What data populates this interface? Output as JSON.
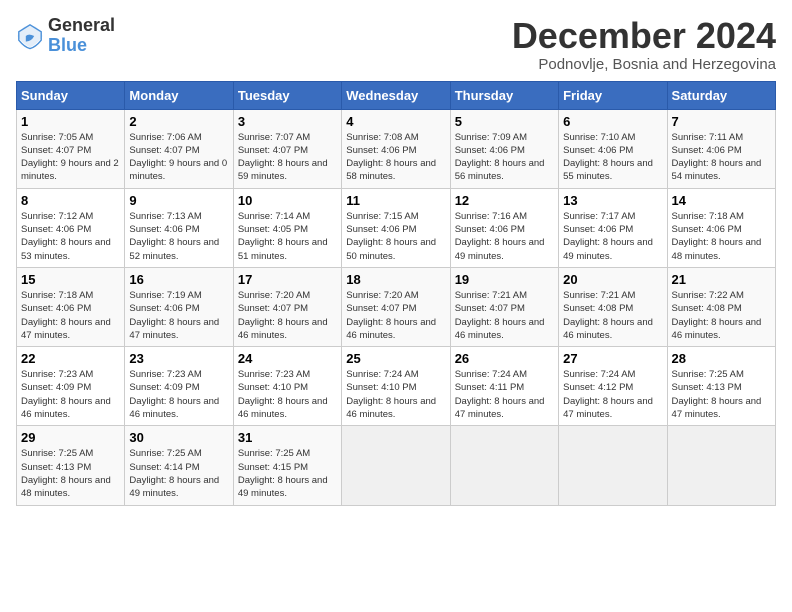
{
  "header": {
    "logo_line1": "General",
    "logo_line2": "Blue",
    "month_year": "December 2024",
    "location": "Podnovlje, Bosnia and Herzegovina"
  },
  "weekdays": [
    "Sunday",
    "Monday",
    "Tuesday",
    "Wednesday",
    "Thursday",
    "Friday",
    "Saturday"
  ],
  "weeks": [
    [
      {
        "day": "1",
        "sunrise": "7:05 AM",
        "sunset": "4:07 PM",
        "daylight": "9 hours and 2 minutes."
      },
      {
        "day": "2",
        "sunrise": "7:06 AM",
        "sunset": "4:07 PM",
        "daylight": "9 hours and 0 minutes."
      },
      {
        "day": "3",
        "sunrise": "7:07 AM",
        "sunset": "4:07 PM",
        "daylight": "8 hours and 59 minutes."
      },
      {
        "day": "4",
        "sunrise": "7:08 AM",
        "sunset": "4:06 PM",
        "daylight": "8 hours and 58 minutes."
      },
      {
        "day": "5",
        "sunrise": "7:09 AM",
        "sunset": "4:06 PM",
        "daylight": "8 hours and 56 minutes."
      },
      {
        "day": "6",
        "sunrise": "7:10 AM",
        "sunset": "4:06 PM",
        "daylight": "8 hours and 55 minutes."
      },
      {
        "day": "7",
        "sunrise": "7:11 AM",
        "sunset": "4:06 PM",
        "daylight": "8 hours and 54 minutes."
      }
    ],
    [
      {
        "day": "8",
        "sunrise": "7:12 AM",
        "sunset": "4:06 PM",
        "daylight": "8 hours and 53 minutes."
      },
      {
        "day": "9",
        "sunrise": "7:13 AM",
        "sunset": "4:06 PM",
        "daylight": "8 hours and 52 minutes."
      },
      {
        "day": "10",
        "sunrise": "7:14 AM",
        "sunset": "4:05 PM",
        "daylight": "8 hours and 51 minutes."
      },
      {
        "day": "11",
        "sunrise": "7:15 AM",
        "sunset": "4:06 PM",
        "daylight": "8 hours and 50 minutes."
      },
      {
        "day": "12",
        "sunrise": "7:16 AM",
        "sunset": "4:06 PM",
        "daylight": "8 hours and 49 minutes."
      },
      {
        "day": "13",
        "sunrise": "7:17 AM",
        "sunset": "4:06 PM",
        "daylight": "8 hours and 49 minutes."
      },
      {
        "day": "14",
        "sunrise": "7:18 AM",
        "sunset": "4:06 PM",
        "daylight": "8 hours and 48 minutes."
      }
    ],
    [
      {
        "day": "15",
        "sunrise": "7:18 AM",
        "sunset": "4:06 PM",
        "daylight": "8 hours and 47 minutes."
      },
      {
        "day": "16",
        "sunrise": "7:19 AM",
        "sunset": "4:06 PM",
        "daylight": "8 hours and 47 minutes."
      },
      {
        "day": "17",
        "sunrise": "7:20 AM",
        "sunset": "4:07 PM",
        "daylight": "8 hours and 46 minutes."
      },
      {
        "day": "18",
        "sunrise": "7:20 AM",
        "sunset": "4:07 PM",
        "daylight": "8 hours and 46 minutes."
      },
      {
        "day": "19",
        "sunrise": "7:21 AM",
        "sunset": "4:07 PM",
        "daylight": "8 hours and 46 minutes."
      },
      {
        "day": "20",
        "sunrise": "7:21 AM",
        "sunset": "4:08 PM",
        "daylight": "8 hours and 46 minutes."
      },
      {
        "day": "21",
        "sunrise": "7:22 AM",
        "sunset": "4:08 PM",
        "daylight": "8 hours and 46 minutes."
      }
    ],
    [
      {
        "day": "22",
        "sunrise": "7:23 AM",
        "sunset": "4:09 PM",
        "daylight": "8 hours and 46 minutes."
      },
      {
        "day": "23",
        "sunrise": "7:23 AM",
        "sunset": "4:09 PM",
        "daylight": "8 hours and 46 minutes."
      },
      {
        "day": "24",
        "sunrise": "7:23 AM",
        "sunset": "4:10 PM",
        "daylight": "8 hours and 46 minutes."
      },
      {
        "day": "25",
        "sunrise": "7:24 AM",
        "sunset": "4:10 PM",
        "daylight": "8 hours and 46 minutes."
      },
      {
        "day": "26",
        "sunrise": "7:24 AM",
        "sunset": "4:11 PM",
        "daylight": "8 hours and 47 minutes."
      },
      {
        "day": "27",
        "sunrise": "7:24 AM",
        "sunset": "4:12 PM",
        "daylight": "8 hours and 47 minutes."
      },
      {
        "day": "28",
        "sunrise": "7:25 AM",
        "sunset": "4:13 PM",
        "daylight": "8 hours and 47 minutes."
      }
    ],
    [
      {
        "day": "29",
        "sunrise": "7:25 AM",
        "sunset": "4:13 PM",
        "daylight": "8 hours and 48 minutes."
      },
      {
        "day": "30",
        "sunrise": "7:25 AM",
        "sunset": "4:14 PM",
        "daylight": "8 hours and 49 minutes."
      },
      {
        "day": "31",
        "sunrise": "7:25 AM",
        "sunset": "4:15 PM",
        "daylight": "8 hours and 49 minutes."
      },
      null,
      null,
      null,
      null
    ]
  ]
}
